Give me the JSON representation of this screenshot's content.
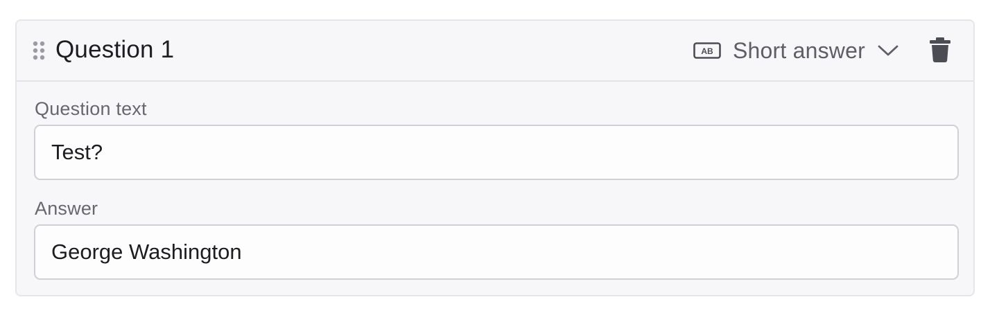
{
  "question": {
    "title": "Question 1",
    "type_label": "Short answer",
    "type_icon": "text-format-ab-icon",
    "drag_icon": "drag-handle-icon",
    "delete_icon": "trash-icon",
    "chevron_icon": "chevron-down-icon",
    "question_text_label": "Question text",
    "question_text_value": "Test?",
    "answer_label": "Answer",
    "answer_value": "George Washington"
  },
  "colors": {
    "card_background": "#f7f7f9",
    "border": "#e6e6ea",
    "input_border": "#cfcfd6",
    "text": "#1c1c21",
    "muted_text": "#5d5e66",
    "icon": "#4b4c54"
  }
}
